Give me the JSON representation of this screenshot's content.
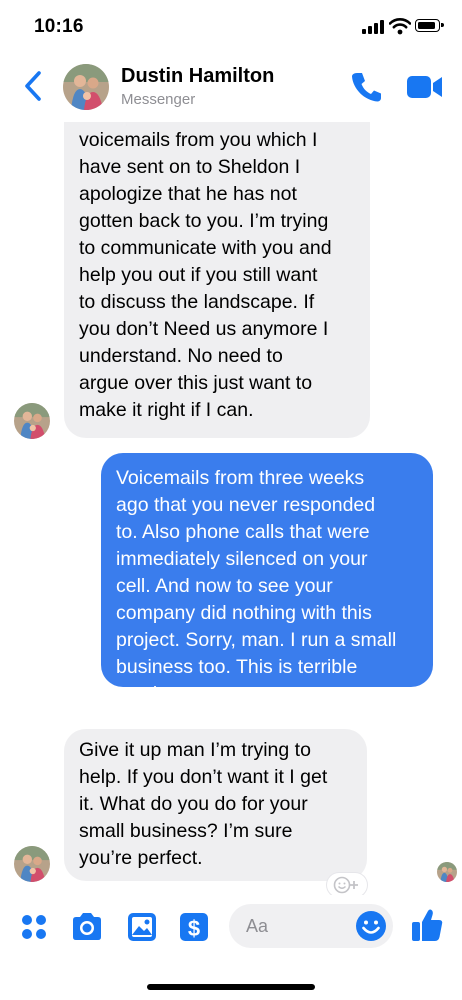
{
  "status_bar": {
    "time": "10:16"
  },
  "header": {
    "contact_name": "Dustin Hamilton",
    "subtitle": "Messenger",
    "back_icon": "chevron-left-icon",
    "call_icon": "phone-icon",
    "video_icon": "video-camera-icon"
  },
  "messages": [
    {
      "direction": "incoming",
      "sender": "Dustin Hamilton",
      "text": "I have received two\nvoicemails from you which I\nhave sent on to Sheldon I\napologize that he has not\ngotten back to you. I’m trying\nto communicate with you and\nhelp you out if you still want\nto discuss the landscape. If\nyou don’t Need us anymore I\nunderstand. No need to\nargue over this just want to\nmake it right if I can."
    },
    {
      "direction": "outgoing",
      "text": "Voicemails from three weeks\nago that you never responded\nto. Also phone calls that were\nimmediately silenced on your\ncell. And now to see your\ncompany did nothing with this\nproject. Sorry, man. I run a small\nbusiness too. This is terrible\nservice."
    },
    {
      "direction": "incoming",
      "sender": "Dustin Hamilton",
      "text": "Give it up man I’m trying to\nhelp. If you don’t want it I get\nit. What do you do for your\nsmall business? I’m sure\nyou’re perfect."
    }
  ],
  "composer": {
    "placeholder": "Aa",
    "icons": [
      "more-icon",
      "camera-icon",
      "image-icon",
      "payment-icon",
      "emoji-icon",
      "thumbs-up-icon"
    ]
  },
  "colors": {
    "accent": "#1877f2",
    "outgoing_bubble": "#3a7ded",
    "incoming_bubble": "#efeff1",
    "muted_text": "#8e8e93"
  }
}
